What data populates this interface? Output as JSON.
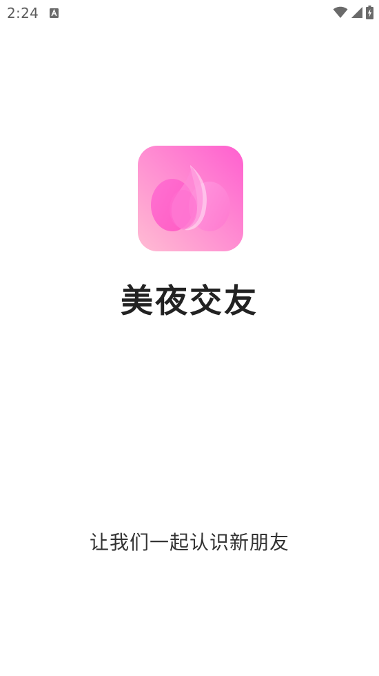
{
  "status_bar": {
    "time": "2:24",
    "notification_icon": "a-badge-icon",
    "wifi_icon": "wifi-icon",
    "signal_icon": "cellular-signal-icon",
    "battery_icon": "battery-charging-icon"
  },
  "splash": {
    "app_name": "美夜交友",
    "slogan": "让我们一起认识新朋友",
    "logo_icon": "app-logo-icon"
  },
  "colors": {
    "background": "#ffffff",
    "logo_gradient_start": "#ff5fd0",
    "logo_gradient_end": "#ffb7d6",
    "title": "#222222",
    "slogan": "#333333"
  }
}
